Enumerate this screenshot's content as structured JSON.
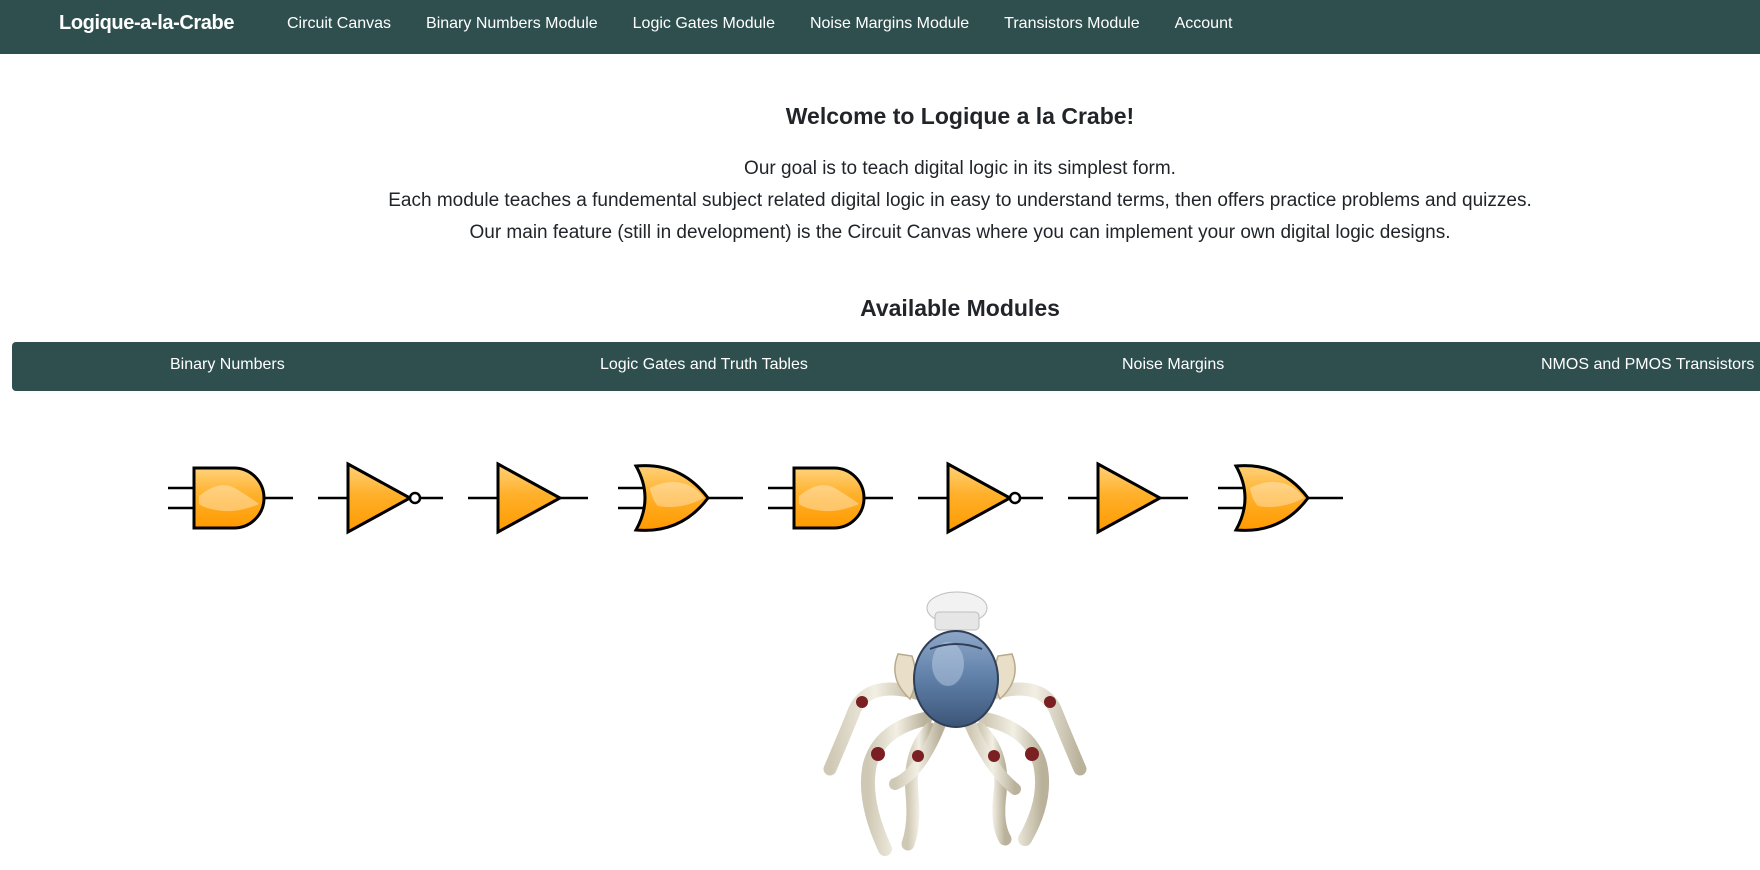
{
  "navbar": {
    "brand": "Logique-a-la-Crabe",
    "links": [
      "Circuit Canvas",
      "Binary Numbers Module",
      "Logic Gates Module",
      "Noise Margins Module",
      "Transistors Module",
      "Account"
    ]
  },
  "intro": {
    "title": "Welcome to Logique a la Crabe!",
    "lines": [
      "Our goal is to teach digital logic in its simplest form.",
      "Each module teaches a fundemental subject related digital logic in easy to understand terms, then offers practice problems and quizzes.",
      "Our main feature (still in development) is the Circuit Canvas where you can implement your own digital logic designs."
    ]
  },
  "modules": {
    "title": "Available Modules",
    "items": [
      "Binary Numbers",
      "Logic Gates and Truth Tables",
      "Noise Margins",
      "NMOS and PMOS Transistors"
    ]
  },
  "gates": [
    "and-gate",
    "not-gate",
    "buffer-gate",
    "or-gate",
    "and-gate",
    "not-gate",
    "buffer-gate",
    "or-gate"
  ],
  "colors": {
    "navbar": "#2f4f4f",
    "gate_fill": "#ffa20f",
    "text": "#212529"
  }
}
